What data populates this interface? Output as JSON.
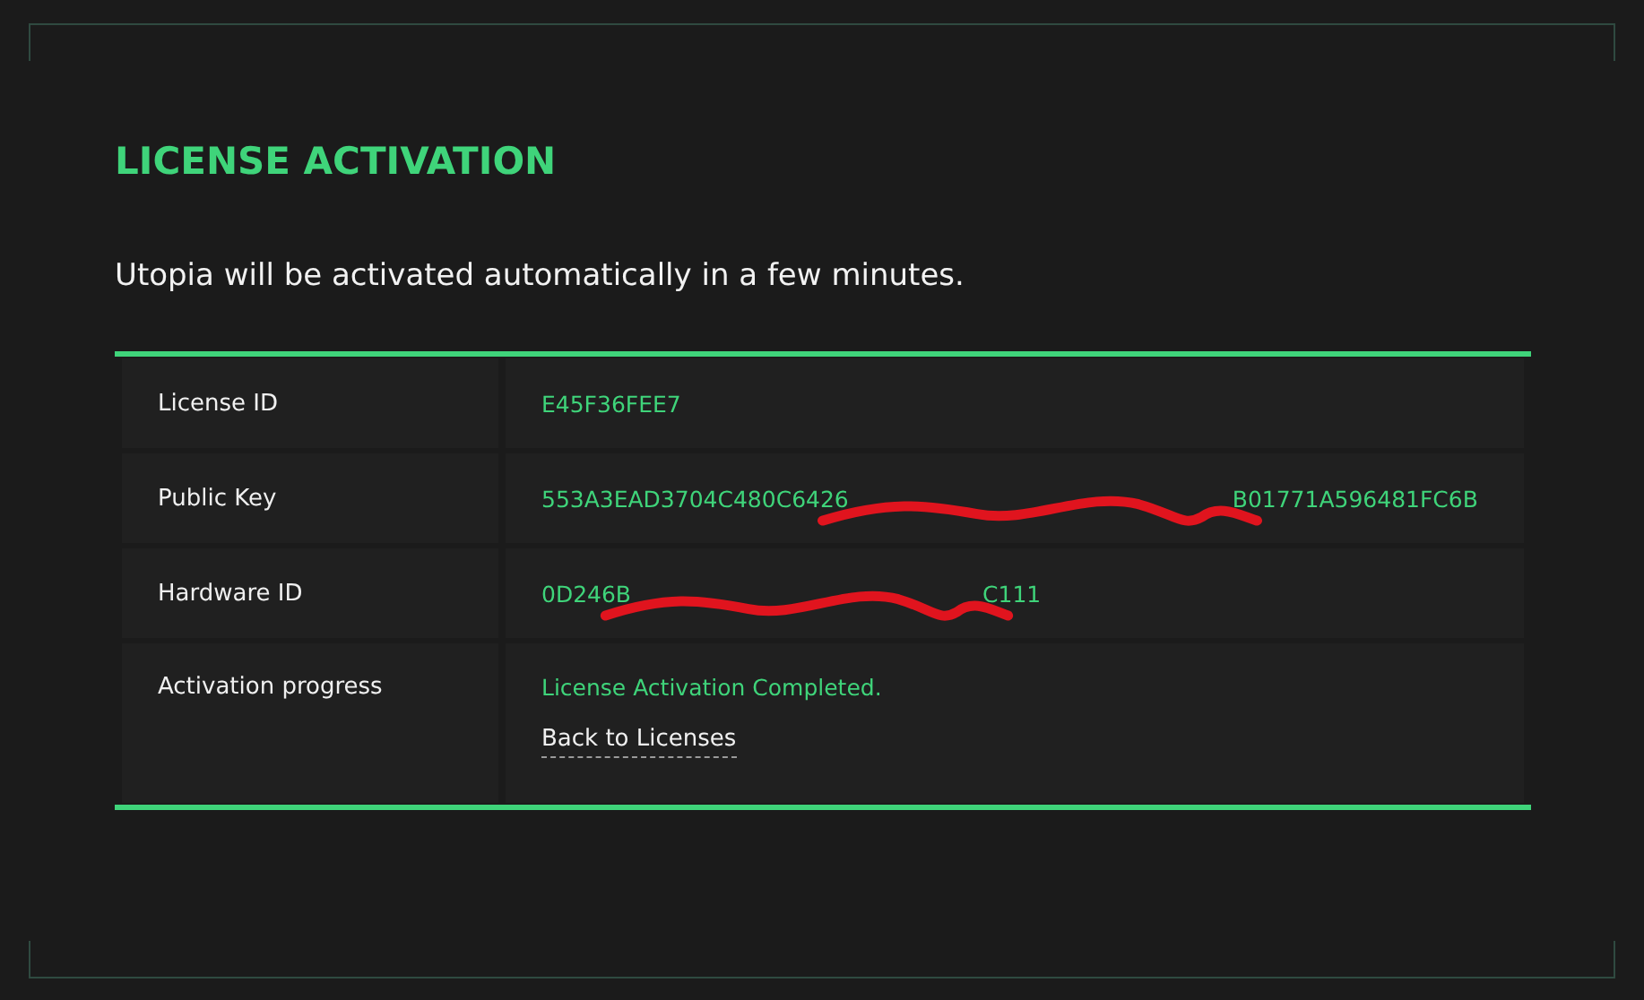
{
  "title": "LICENSE ACTIVATION",
  "message": "Utopia will be activated automatically in a few minutes.",
  "rows": [
    {
      "kind": "text",
      "label": "License ID",
      "value": "E45F36FEE7"
    },
    {
      "kind": "redacted",
      "label": "Public Key",
      "visible_start": "553A3EAD3704C480C6426",
      "visible_end": "B01771A596481FC6B"
    },
    {
      "kind": "redacted",
      "label": "Hardware ID",
      "visible_start": "0D246B",
      "visible_end": "C111"
    },
    {
      "kind": "progress",
      "label": "Activation progress",
      "value": "License Activation Completed.",
      "link": "Back to Licenses"
    }
  ]
}
